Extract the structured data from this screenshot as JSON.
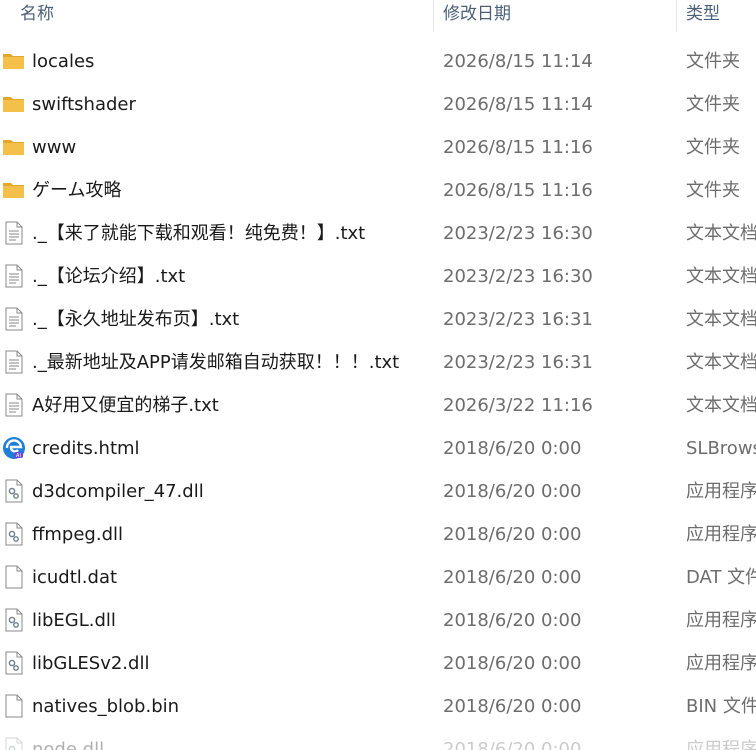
{
  "columns": {
    "name": "名称",
    "date_modified": "修改日期",
    "type": "类型"
  },
  "files": [
    {
      "name": "locales",
      "date": "2026/8/15 11:14",
      "type": "文件夹",
      "icon": "folder-icon"
    },
    {
      "name": "swiftshader",
      "date": "2026/8/15 11:14",
      "type": "文件夹",
      "icon": "folder-icon"
    },
    {
      "name": "www",
      "date": "2026/8/15 11:16",
      "type": "文件夹",
      "icon": "folder-icon"
    },
    {
      "name": "ゲーム攻略",
      "date": "2026/8/15 11:16",
      "type": "文件夹",
      "icon": "folder-icon"
    },
    {
      "name": "._【来了就能下载和观看！纯免费！】.txt",
      "date": "2023/2/23 16:30",
      "type": "文本文档",
      "icon": "text-file-icon"
    },
    {
      "name": "._【论坛介绍】.txt",
      "date": "2023/2/23 16:30",
      "type": "文本文档",
      "icon": "text-file-icon"
    },
    {
      "name": "._【永久地址发布页】.txt",
      "date": "2023/2/23 16:31",
      "type": "文本文档",
      "icon": "text-file-icon"
    },
    {
      "name": "._最新地址及APP请发邮箱自动获取！！！.txt",
      "date": "2023/2/23 16:31",
      "type": "文本文档",
      "icon": "text-file-icon"
    },
    {
      "name": "A好用又便宜的梯子.txt",
      "date": "2026/3/22 11:16",
      "type": "文本文档",
      "icon": "text-file-icon"
    },
    {
      "name": "credits.html",
      "date": "2018/6/20 0:00",
      "type": "SLBrowser",
      "icon": "browser-html-icon"
    },
    {
      "name": "d3dcompiler_47.dll",
      "date": "2018/6/20 0:00",
      "type": "应用程序扩展",
      "icon": "dll-file-icon"
    },
    {
      "name": "ffmpeg.dll",
      "date": "2018/6/20 0:00",
      "type": "应用程序扩展",
      "icon": "dll-file-icon"
    },
    {
      "name": "icudtl.dat",
      "date": "2018/6/20 0:00",
      "type": "DAT 文件",
      "icon": "blank-file-icon"
    },
    {
      "name": "libEGL.dll",
      "date": "2018/6/20 0:00",
      "type": "应用程序扩展",
      "icon": "dll-file-icon"
    },
    {
      "name": "libGLESv2.dll",
      "date": "2018/6/20 0:00",
      "type": "应用程序扩展",
      "icon": "dll-file-icon"
    },
    {
      "name": "natives_blob.bin",
      "date": "2018/6/20 0:00",
      "type": "BIN 文件",
      "icon": "blank-file-icon"
    },
    {
      "name": "node.dll",
      "date": "2018/6/20 0:00",
      "type": "应用程序扩展",
      "icon": "dll-file-icon"
    }
  ],
  "colors": {
    "folder": "#f4c04a",
    "folder_dark": "#e0a82e",
    "header_text": "#4c607a",
    "name_text": "#1a1a1a",
    "meta_text": "#6d6d6d",
    "browser_blue": "#1e7fd8"
  }
}
